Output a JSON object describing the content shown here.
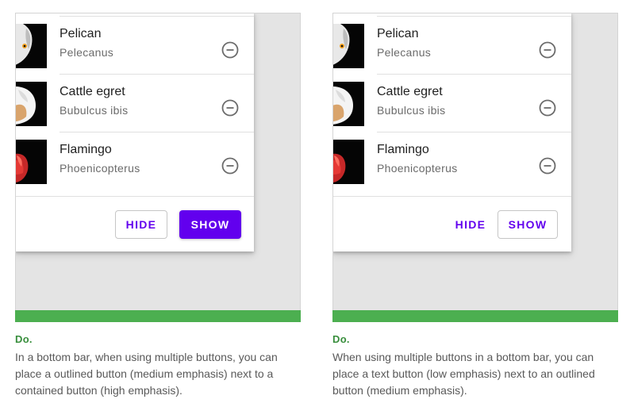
{
  "colors": {
    "primary": "#6200ee",
    "do_green": "#4caf50",
    "do_text": "#388e3c",
    "canvas": "#e4e4e4"
  },
  "list_items": [
    {
      "title": "Pelican",
      "subtitle": "Pelecanus",
      "icon": "remove-circle-icon"
    },
    {
      "title": "Cattle egret",
      "subtitle": "Bubulcus ibis",
      "icon": "remove-circle-icon"
    },
    {
      "title": "Flamingo",
      "subtitle": "Phoenicopterus",
      "icon": "remove-circle-icon"
    }
  ],
  "examples": [
    {
      "hide_label": "HIDE",
      "show_label": "SHOW",
      "hide_style": "outlined",
      "show_style": "contained",
      "verdict": "Do.",
      "description": "In a bottom bar, when using multiple buttons, you can place a outlined button (medium emphasis) next to a contained button (high emphasis)."
    },
    {
      "hide_label": "HIDE",
      "show_label": "SHOW",
      "hide_style": "text",
      "show_style": "outlined",
      "verdict": "Do.",
      "description": "When using multiple buttons in a bottom bar, you can place a text button (low emphasis) next to an outlined button (medium emphasis)."
    }
  ]
}
